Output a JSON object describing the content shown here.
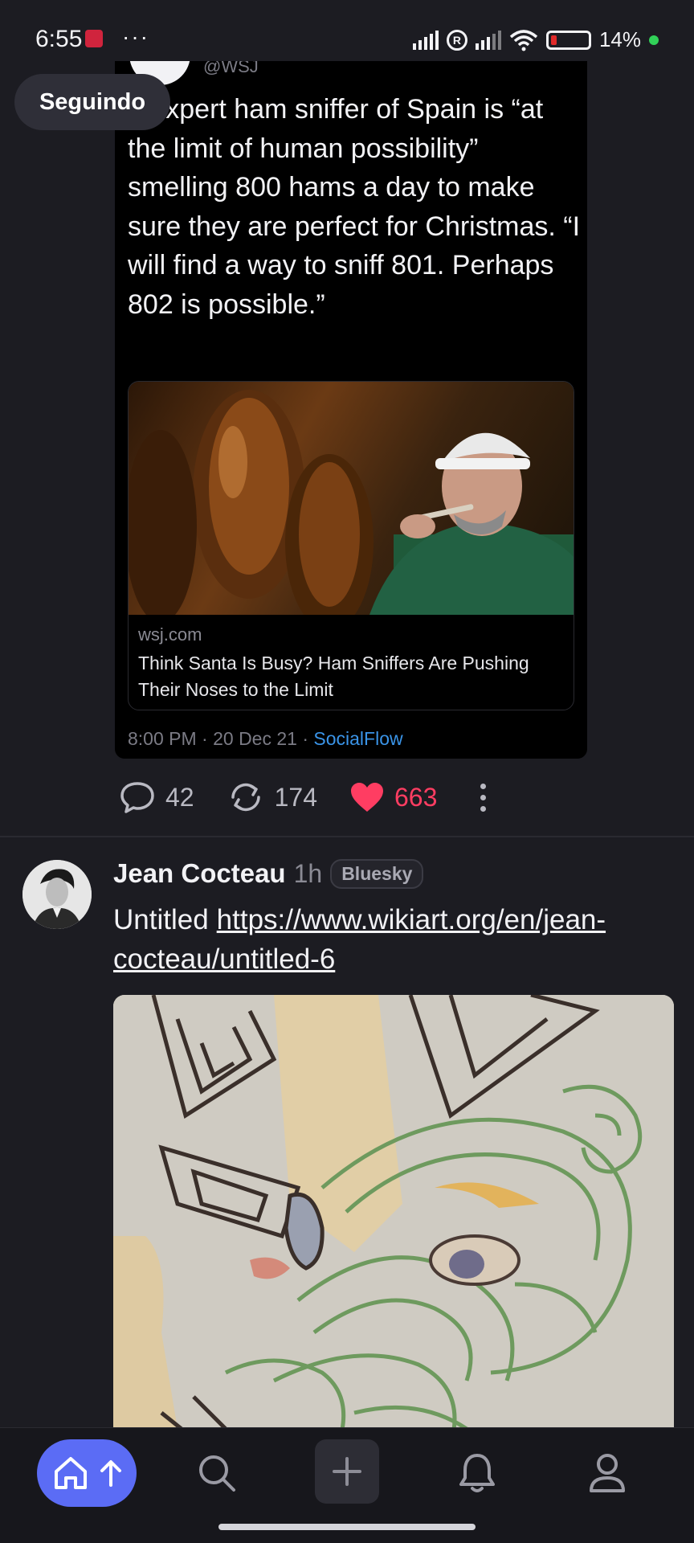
{
  "status_bar": {
    "time": "6:55",
    "more": "···",
    "battery_pct": "14%",
    "battery_level": 0.14
  },
  "feed": {
    "following_pill": "Seguindo"
  },
  "quoted_tweet": {
    "handle": "@WSJ",
    "text": "e expert ham sniffer of Spain is “at the limit of human possibility” smelling 800 hams a day to make sure they are perfect for Christmas. “I will find a way to sniff 801. Perhaps 802 is possible.”",
    "link_domain": "wsj.com",
    "link_title": "Think Santa Is Busy? Ham Sniffers Are Pushing Their Noses to the Limit",
    "meta_time": "8:00 PM · 20 Dec 21 · ",
    "meta_source": "SocialFlow"
  },
  "post1_actions": {
    "replies": "42",
    "reposts": "174",
    "likes": "663"
  },
  "post2": {
    "author": "Jean Cocteau",
    "time": "1h",
    "badge": "Bluesky",
    "text": "Untitled",
    "link": "https://www.wikiart.org/en/jean-cocteau/untitled-6"
  },
  "colors": {
    "accent": "#5b6cf5",
    "like": "#ff3d62",
    "link": "#3a94e8",
    "background": "#1c1c22"
  },
  "icons": {
    "status": [
      "notification-app-icon",
      "signal-icon",
      "registered-icon",
      "wifi-icon",
      "battery-icon"
    ],
    "actions": [
      "reply-icon",
      "repost-icon",
      "heart-icon",
      "more-vertical-icon"
    ],
    "nav": [
      "home-icon",
      "arrow-up-icon",
      "search-icon",
      "plus-icon",
      "bell-icon",
      "profile-icon"
    ]
  }
}
